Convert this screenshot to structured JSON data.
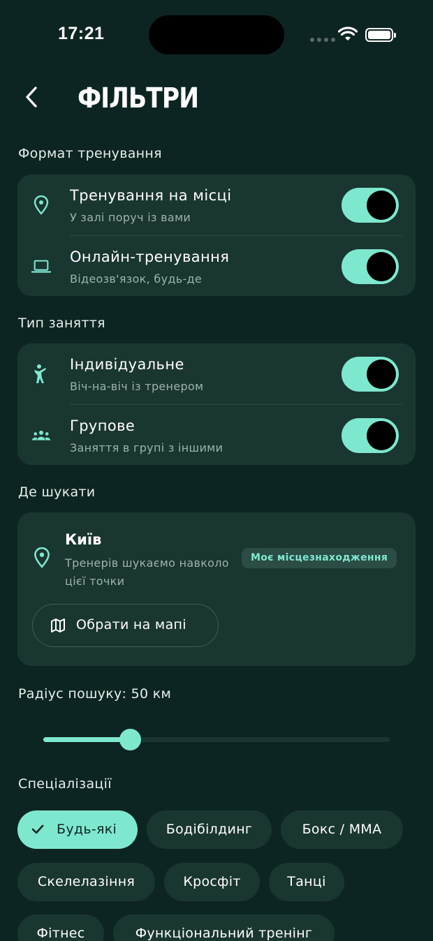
{
  "status_bar": {
    "time": "17:21"
  },
  "header": {
    "title": "ФІЛЬТРИ"
  },
  "format_section": {
    "label": "Формат тренування",
    "items": [
      {
        "title": "Тренування на місці",
        "subtitle": "У залі поруч із вами",
        "icon": "location-pin-icon",
        "enabled": true
      },
      {
        "title": "Онлайн-тренування",
        "subtitle": "Відеозв'язок, будь-де",
        "icon": "laptop-icon",
        "enabled": true
      }
    ]
  },
  "type_section": {
    "label": "Тип заняття",
    "items": [
      {
        "title": "Індивідуальне",
        "subtitle": "Віч-на-віч із тренером",
        "icon": "person-icon",
        "enabled": true
      },
      {
        "title": "Групове",
        "subtitle": "Заняття в групі з іншими",
        "icon": "group-icon",
        "enabled": true
      }
    ]
  },
  "location_section": {
    "label": "Де шукати",
    "city": "Київ",
    "description": "Тренерів шукаємо навколо цієї точки",
    "badge": "Моє місцезнаходження",
    "map_button": "Обрати на мапі"
  },
  "radius": {
    "label": "Радіус пошуку: 50 км",
    "value_km": 50,
    "fraction": 0.25
  },
  "specializations": {
    "label": "Спеціалізації",
    "chips": [
      {
        "label": "Будь-які",
        "selected": true
      },
      {
        "label": "Бодібілдинг",
        "selected": false
      },
      {
        "label": "Бокс / MMA",
        "selected": false
      },
      {
        "label": "Скелелазіння",
        "selected": false
      },
      {
        "label": "Кросфіт",
        "selected": false
      },
      {
        "label": "Танці",
        "selected": false
      },
      {
        "label": "Фітнес",
        "selected": false
      },
      {
        "label": "Функціональний тренінг",
        "selected": false
      }
    ]
  },
  "colors": {
    "background": "#0d2522",
    "card": "#1a3631",
    "accent": "#7ee8cf",
    "muted_text": "#9db3ae"
  }
}
